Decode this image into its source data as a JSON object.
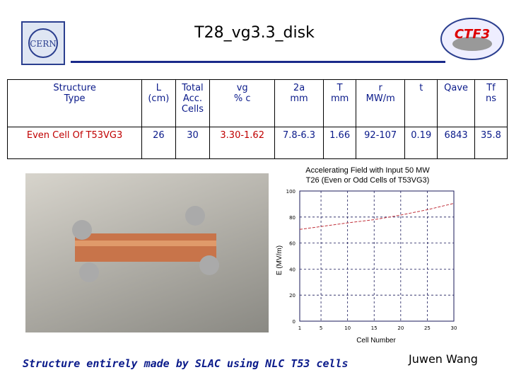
{
  "title": "T28_vg3.3_disk",
  "logos": {
    "left": "CERN",
    "right": "CTF3"
  },
  "table": {
    "headers": [
      [
        "Structure",
        "Type"
      ],
      [
        "L",
        "(cm)"
      ],
      [
        "Total",
        "Acc.",
        "Cells"
      ],
      [
        "vg",
        "% c"
      ],
      [
        "2a",
        "mm"
      ],
      [
        "T",
        "mm"
      ],
      [
        "r",
        "MW/m"
      ],
      [
        "t"
      ],
      [
        "Qave"
      ],
      [
        "Tf",
        "ns"
      ]
    ],
    "row": [
      "Even Cell Of T53VG3",
      "26",
      "30",
      "3.30-1.62",
      "7.8-6.3",
      "1.66",
      "92-107",
      "0.19",
      "6843",
      "35.8"
    ]
  },
  "chart_data": {
    "type": "line",
    "title": "Accelerating Field with Input 50 MW",
    "subtitle": "T26 (Even or Odd Cells of T53VG3)",
    "xlabel": "Cell Number",
    "ylabel": "E (MV/m)",
    "xlim": [
      1,
      30
    ],
    "ylim": [
      0,
      100
    ],
    "xticks": [
      1,
      5,
      10,
      15,
      20,
      25,
      30
    ],
    "yticks": [
      0,
      20,
      40,
      60,
      80,
      100
    ],
    "grid": true,
    "x": [
      1,
      5,
      10,
      15,
      20,
      25,
      30
    ],
    "y": [
      70.5,
      72.7,
      75.5,
      78,
      81.5,
      85.6,
      90.5
    ],
    "line_color": "#c0303a"
  },
  "footer": "Structure entirely made by SLAC using NLC T53 cells",
  "author": "Juwen Wang"
}
